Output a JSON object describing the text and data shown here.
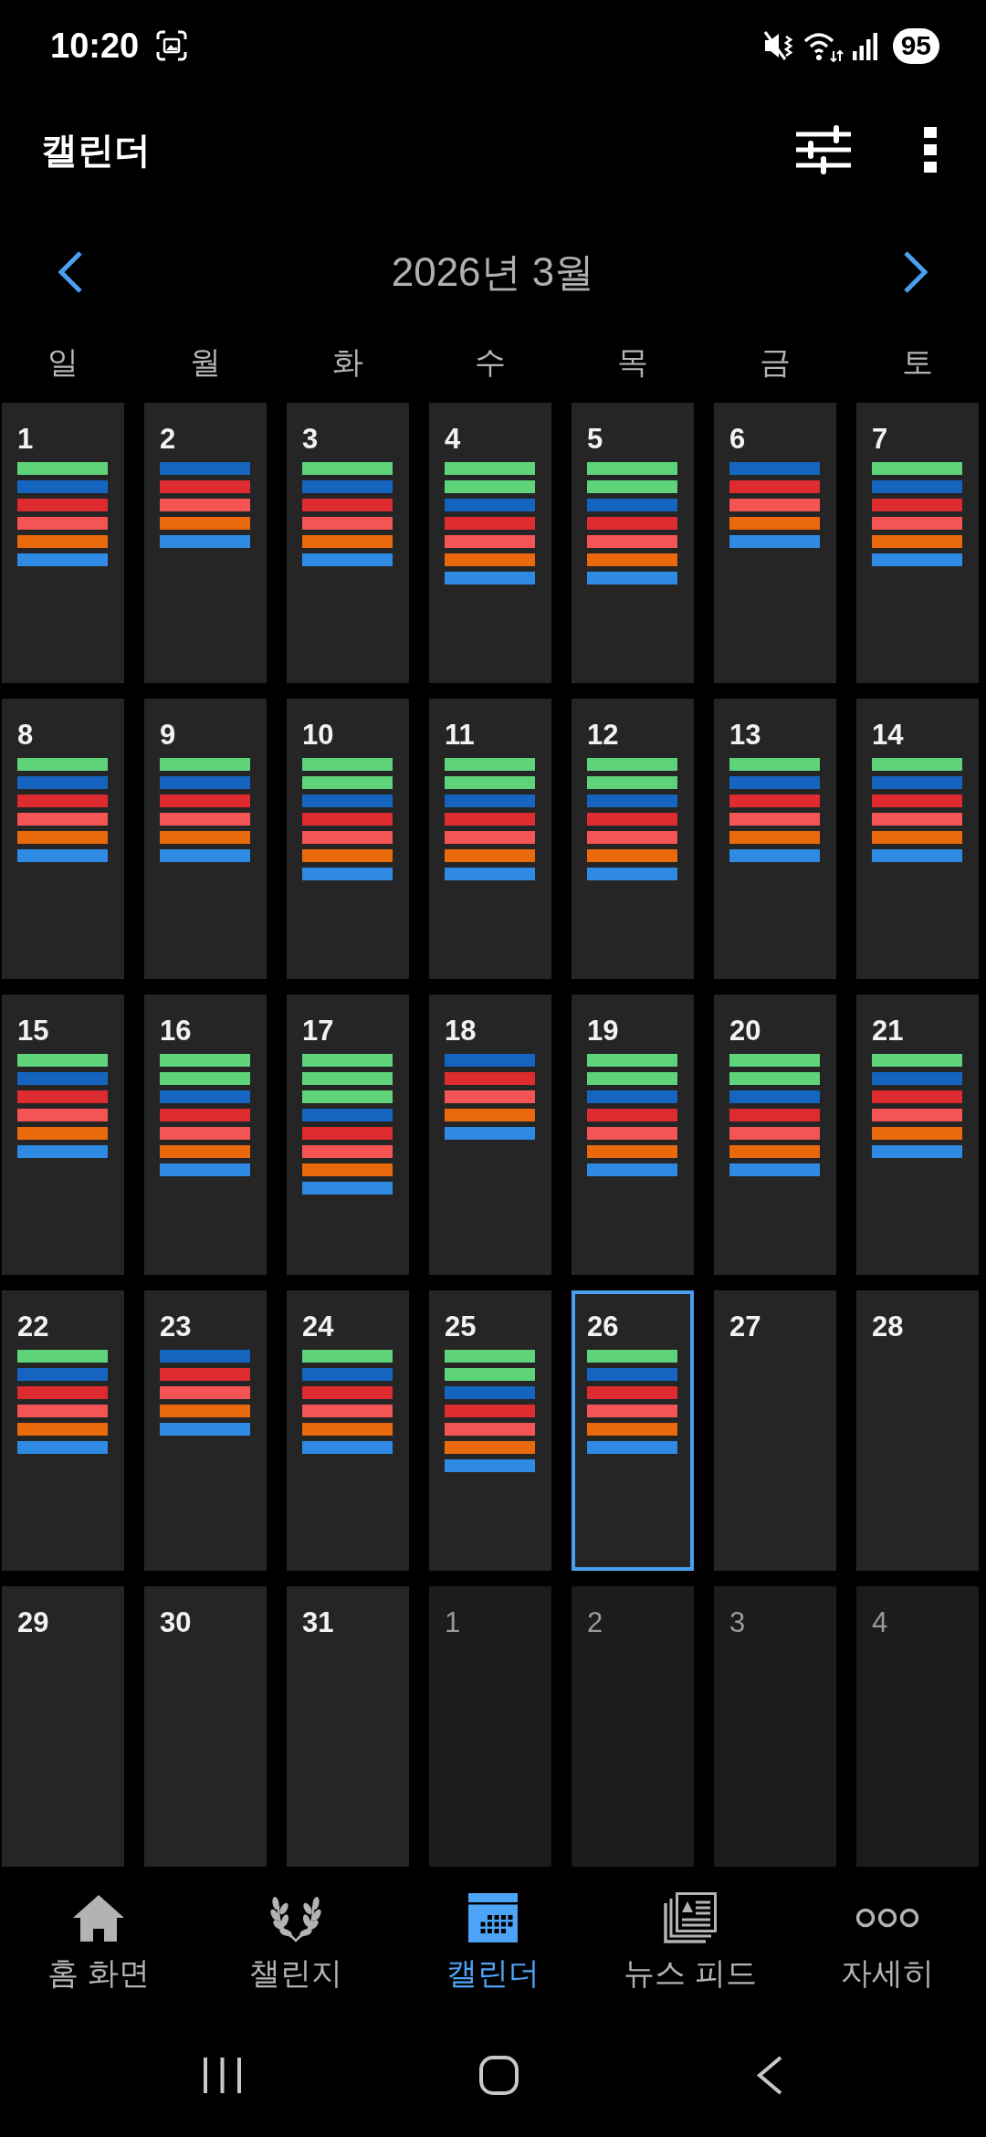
{
  "status_bar": {
    "time": "10:20",
    "battery": "95"
  },
  "app_bar": {
    "title": "캘린더"
  },
  "calendar": {
    "month_title": "2026년 3월",
    "weekdays": [
      "일",
      "월",
      "화",
      "수",
      "목",
      "금",
      "토"
    ],
    "weeks": [
      {
        "days": [
          {
            "date": "1",
            "current_month": true,
            "selected": false,
            "events": [
              {
                "color": "#5fd37a"
              },
              {
                "color": "#1565c0"
              },
              {
                "color": "#de2b2f"
              },
              {
                "color": "#f55455"
              },
              {
                "color": "#e9690c"
              },
              {
                "color": "#2f8ae3"
              }
            ]
          },
          {
            "date": "2",
            "current_month": true,
            "selected": false,
            "events": [
              {
                "color": "#1565c0"
              },
              {
                "color": "#de2b2f"
              },
              {
                "color": "#f55455"
              },
              {
                "color": "#e9690c"
              },
              {
                "color": "#2f8ae3"
              }
            ]
          },
          {
            "date": "3",
            "current_month": true,
            "selected": false,
            "events": [
              {
                "color": "#5fd37a"
              },
              {
                "color": "#1565c0"
              },
              {
                "color": "#de2b2f"
              },
              {
                "color": "#f55455"
              },
              {
                "color": "#e9690c"
              },
              {
                "color": "#2f8ae3"
              }
            ]
          },
          {
            "date": "4",
            "current_month": true,
            "selected": false,
            "events": [
              {
                "color": "#5fd37a"
              },
              {
                "color": "#5fd37a"
              },
              {
                "color": "#1565c0"
              },
              {
                "color": "#de2b2f"
              },
              {
                "color": "#f55455"
              },
              {
                "color": "#e9690c"
              },
              {
                "color": "#2f8ae3"
              }
            ]
          },
          {
            "date": "5",
            "current_month": true,
            "selected": false,
            "events": [
              {
                "color": "#5fd37a"
              },
              {
                "color": "#5fd37a"
              },
              {
                "color": "#1565c0"
              },
              {
                "color": "#de2b2f"
              },
              {
                "color": "#f55455"
              },
              {
                "color": "#e9690c"
              },
              {
                "color": "#2f8ae3"
              }
            ]
          },
          {
            "date": "6",
            "current_month": true,
            "selected": false,
            "events": [
              {
                "color": "#1565c0"
              },
              {
                "color": "#de2b2f"
              },
              {
                "color": "#f55455"
              },
              {
                "color": "#e9690c"
              },
              {
                "color": "#2f8ae3"
              }
            ]
          },
          {
            "date": "7",
            "current_month": true,
            "selected": false,
            "events": [
              {
                "color": "#5fd37a"
              },
              {
                "color": "#1565c0"
              },
              {
                "color": "#de2b2f"
              },
              {
                "color": "#f55455"
              },
              {
                "color": "#e9690c"
              },
              {
                "color": "#2f8ae3"
              }
            ]
          }
        ]
      },
      {
        "days": [
          {
            "date": "8",
            "current_month": true,
            "selected": false,
            "events": [
              {
                "color": "#5fd37a"
              },
              {
                "color": "#1565c0"
              },
              {
                "color": "#de2b2f"
              },
              {
                "color": "#f55455"
              },
              {
                "color": "#e9690c"
              },
              {
                "color": "#2f8ae3"
              }
            ]
          },
          {
            "date": "9",
            "current_month": true,
            "selected": false,
            "events": [
              {
                "color": "#5fd37a"
              },
              {
                "color": "#1565c0"
              },
              {
                "color": "#de2b2f"
              },
              {
                "color": "#f55455"
              },
              {
                "color": "#e9690c"
              },
              {
                "color": "#2f8ae3"
              }
            ]
          },
          {
            "date": "10",
            "current_month": true,
            "selected": false,
            "events": [
              {
                "color": "#5fd37a"
              },
              {
                "color": "#5fd37a"
              },
              {
                "color": "#1565c0"
              },
              {
                "color": "#de2b2f"
              },
              {
                "color": "#f55455"
              },
              {
                "color": "#e9690c"
              },
              {
                "color": "#2f8ae3"
              }
            ]
          },
          {
            "date": "11",
            "current_month": true,
            "selected": false,
            "events": [
              {
                "color": "#5fd37a"
              },
              {
                "color": "#5fd37a"
              },
              {
                "color": "#1565c0"
              },
              {
                "color": "#de2b2f"
              },
              {
                "color": "#f55455"
              },
              {
                "color": "#e9690c"
              },
              {
                "color": "#2f8ae3"
              }
            ]
          },
          {
            "date": "12",
            "current_month": true,
            "selected": false,
            "events": [
              {
                "color": "#5fd37a"
              },
              {
                "color": "#5fd37a"
              },
              {
                "color": "#1565c0"
              },
              {
                "color": "#de2b2f"
              },
              {
                "color": "#f55455"
              },
              {
                "color": "#e9690c"
              },
              {
                "color": "#2f8ae3"
              }
            ]
          },
          {
            "date": "13",
            "current_month": true,
            "selected": false,
            "events": [
              {
                "color": "#5fd37a"
              },
              {
                "color": "#1565c0"
              },
              {
                "color": "#de2b2f"
              },
              {
                "color": "#f55455"
              },
              {
                "color": "#e9690c"
              },
              {
                "color": "#2f8ae3"
              }
            ]
          },
          {
            "date": "14",
            "current_month": true,
            "selected": false,
            "events": [
              {
                "color": "#5fd37a"
              },
              {
                "color": "#1565c0"
              },
              {
                "color": "#de2b2f"
              },
              {
                "color": "#f55455"
              },
              {
                "color": "#e9690c"
              },
              {
                "color": "#2f8ae3"
              }
            ]
          }
        ]
      },
      {
        "days": [
          {
            "date": "15",
            "current_month": true,
            "selected": false,
            "events": [
              {
                "color": "#5fd37a"
              },
              {
                "color": "#1565c0"
              },
              {
                "color": "#de2b2f"
              },
              {
                "color": "#f55455"
              },
              {
                "color": "#e9690c"
              },
              {
                "color": "#2f8ae3"
              }
            ]
          },
          {
            "date": "16",
            "current_month": true,
            "selected": false,
            "events": [
              {
                "color": "#5fd37a"
              },
              {
                "color": "#5fd37a"
              },
              {
                "color": "#1565c0"
              },
              {
                "color": "#de2b2f"
              },
              {
                "color": "#f55455"
              },
              {
                "color": "#e9690c"
              },
              {
                "color": "#2f8ae3"
              }
            ]
          },
          {
            "date": "17",
            "current_month": true,
            "selected": false,
            "events": [
              {
                "color": "#5fd37a"
              },
              {
                "color": "#5fd37a"
              },
              {
                "color": "#5fd37a"
              },
              {
                "color": "#1565c0"
              },
              {
                "color": "#de2b2f"
              },
              {
                "color": "#f55455"
              },
              {
                "color": "#e9690c"
              },
              {
                "color": "#2f8ae3"
              }
            ]
          },
          {
            "date": "18",
            "current_month": true,
            "selected": false,
            "events": [
              {
                "color": "#1565c0"
              },
              {
                "color": "#de2b2f"
              },
              {
                "color": "#f55455"
              },
              {
                "color": "#e9690c"
              },
              {
                "color": "#2f8ae3"
              }
            ]
          },
          {
            "date": "19",
            "current_month": true,
            "selected": false,
            "events": [
              {
                "color": "#5fd37a"
              },
              {
                "color": "#5fd37a"
              },
              {
                "color": "#1565c0"
              },
              {
                "color": "#de2b2f"
              },
              {
                "color": "#f55455"
              },
              {
                "color": "#e9690c"
              },
              {
                "color": "#2f8ae3"
              }
            ]
          },
          {
            "date": "20",
            "current_month": true,
            "selected": false,
            "events": [
              {
                "color": "#5fd37a"
              },
              {
                "color": "#5fd37a"
              },
              {
                "color": "#1565c0"
              },
              {
                "color": "#de2b2f"
              },
              {
                "color": "#f55455"
              },
              {
                "color": "#e9690c"
              },
              {
                "color": "#2f8ae3"
              }
            ]
          },
          {
            "date": "21",
            "current_month": true,
            "selected": false,
            "events": [
              {
                "color": "#5fd37a"
              },
              {
                "color": "#1565c0"
              },
              {
                "color": "#de2b2f"
              },
              {
                "color": "#f55455"
              },
              {
                "color": "#e9690c"
              },
              {
                "color": "#2f8ae3"
              }
            ]
          }
        ]
      },
      {
        "days": [
          {
            "date": "22",
            "current_month": true,
            "selected": false,
            "events": [
              {
                "color": "#5fd37a"
              },
              {
                "color": "#1565c0"
              },
              {
                "color": "#de2b2f"
              },
              {
                "color": "#f55455"
              },
              {
                "color": "#e9690c"
              },
              {
                "color": "#2f8ae3"
              }
            ]
          },
          {
            "date": "23",
            "current_month": true,
            "selected": false,
            "events": [
              {
                "color": "#1565c0"
              },
              {
                "color": "#de2b2f"
              },
              {
                "color": "#f55455"
              },
              {
                "color": "#e9690c"
              },
              {
                "color": "#2f8ae3"
              }
            ]
          },
          {
            "date": "24",
            "current_month": true,
            "selected": false,
            "events": [
              {
                "color": "#5fd37a"
              },
              {
                "color": "#1565c0"
              },
              {
                "color": "#de2b2f"
              },
              {
                "color": "#f55455"
              },
              {
                "color": "#e9690c"
              },
              {
                "color": "#2f8ae3"
              }
            ]
          },
          {
            "date": "25",
            "current_month": true,
            "selected": false,
            "events": [
              {
                "color": "#5fd37a"
              },
              {
                "color": "#5fd37a"
              },
              {
                "color": "#1565c0"
              },
              {
                "color": "#de2b2f"
              },
              {
                "color": "#f55455"
              },
              {
                "color": "#e9690c"
              },
              {
                "color": "#2f8ae3"
              }
            ]
          },
          {
            "date": "26",
            "current_month": true,
            "selected": true,
            "events": [
              {
                "color": "#5fd37a"
              },
              {
                "color": "#1565c0"
              },
              {
                "color": "#de2b2f"
              },
              {
                "color": "#f55455"
              },
              {
                "color": "#e9690c"
              },
              {
                "color": "#2f8ae3"
              }
            ]
          },
          {
            "date": "27",
            "current_month": true,
            "selected": false
          },
          {
            "date": "28",
            "current_month": true,
            "selected": false
          }
        ]
      },
      {
        "days": [
          {
            "date": "29",
            "current_month": true,
            "selected": false
          },
          {
            "date": "30",
            "current_month": true,
            "selected": false
          },
          {
            "date": "31",
            "current_month": true,
            "selected": false
          },
          {
            "date": "1",
            "current_month": false,
            "selected": false
          },
          {
            "date": "2",
            "current_month": false,
            "selected": false
          },
          {
            "date": "3",
            "current_month": false,
            "selected": false
          },
          {
            "date": "4",
            "current_month": false,
            "selected": false
          }
        ]
      }
    ]
  },
  "bottom_nav": [
    {
      "label": "홈 화면",
      "selected": false
    },
    {
      "label": "챌린지",
      "selected": false
    },
    {
      "label": "캘린더",
      "selected": true
    },
    {
      "label": "뉴스 피드",
      "selected": false
    },
    {
      "label": "자세히",
      "selected": false
    }
  ]
}
